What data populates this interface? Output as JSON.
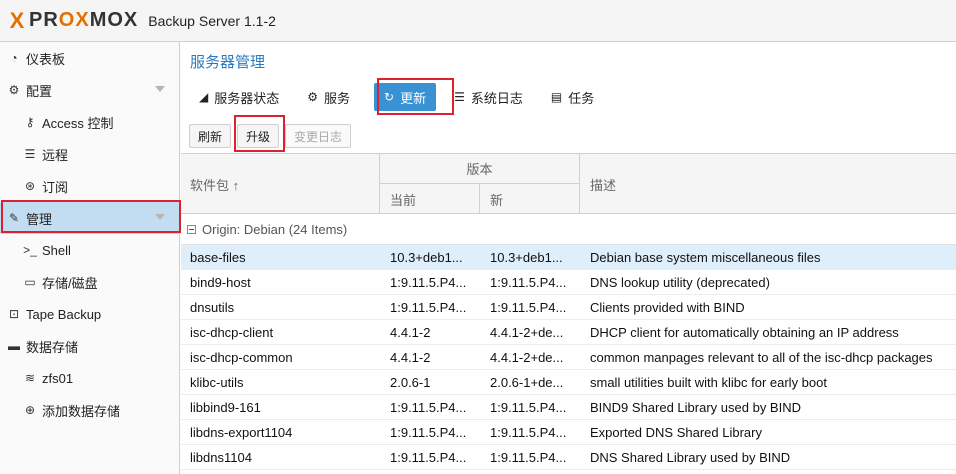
{
  "header": {
    "logo_mark": "X",
    "logo_word_a": "PR",
    "logo_word_b": "OX",
    "logo_word_c": "MOX",
    "product": "Backup Server 1.1-2",
    "brand_color": "#e57000"
  },
  "sidebar": {
    "items": [
      {
        "label": "仪表板",
        "icon": "dashboard-icon"
      },
      {
        "label": "配置",
        "icon": "gears-icon"
      },
      {
        "label": "Access 控制",
        "icon": "key-icon"
      },
      {
        "label": "远程",
        "icon": "server-icon"
      },
      {
        "label": "订阅",
        "icon": "support-icon"
      },
      {
        "label": "管理",
        "icon": "wrench-icon"
      },
      {
        "label": "Shell",
        "icon": "terminal-icon"
      },
      {
        "label": "存储/磁盘",
        "icon": "hdd-icon"
      },
      {
        "label": "Tape Backup",
        "icon": "tape-icon"
      },
      {
        "label": "数据存储",
        "icon": "archive-icon"
      },
      {
        "label": "zfs01",
        "icon": "database-icon"
      },
      {
        "label": "添加数据存储",
        "icon": "plus-circle-icon"
      }
    ]
  },
  "main": {
    "title": "服务器管理",
    "tabs": [
      {
        "label": "服务器状态",
        "icon": "area-chart-icon"
      },
      {
        "label": "服务",
        "icon": "gears-icon"
      },
      {
        "label": "更新",
        "icon": "refresh-icon"
      },
      {
        "label": "系统日志",
        "icon": "list-icon"
      },
      {
        "label": "任务",
        "icon": "list-alt-icon"
      }
    ],
    "toolbar": {
      "refresh": "刷新",
      "upgrade": "升级",
      "changelog": "变更日志"
    },
    "grid": {
      "col_package": "软件包 ↑",
      "col_version": "版本",
      "col_current": "当前",
      "col_new": "新",
      "col_description": "描述",
      "group": "Origin: Debian (24 Items)",
      "rows": [
        {
          "pkg": "base-files",
          "cur": "10.3+deb1...",
          "new": "10.3+deb1...",
          "desc": "Debian base system miscellaneous files"
        },
        {
          "pkg": "bind9-host",
          "cur": "1:9.11.5.P4...",
          "new": "1:9.11.5.P4...",
          "desc": "DNS lookup utility (deprecated)"
        },
        {
          "pkg": "dnsutils",
          "cur": "1:9.11.5.P4...",
          "new": "1:9.11.5.P4...",
          "desc": "Clients provided with BIND"
        },
        {
          "pkg": "isc-dhcp-client",
          "cur": "4.4.1-2",
          "new": "4.4.1-2+de...",
          "desc": "DHCP client for automatically obtaining an IP address"
        },
        {
          "pkg": "isc-dhcp-common",
          "cur": "4.4.1-2",
          "new": "4.4.1-2+de...",
          "desc": "common manpages relevant to all of the isc-dhcp packages"
        },
        {
          "pkg": "klibc-utils",
          "cur": "2.0.6-1",
          "new": "2.0.6-1+de...",
          "desc": "small utilities built with klibc for early boot"
        },
        {
          "pkg": "libbind9-161",
          "cur": "1:9.11.5.P4...",
          "new": "1:9.11.5.P4...",
          "desc": "BIND9 Shared Library used by BIND"
        },
        {
          "pkg": "libdns-export1104",
          "cur": "1:9.11.5.P4...",
          "new": "1:9.11.5.P4...",
          "desc": "Exported DNS Shared Library"
        },
        {
          "pkg": "libdns1104",
          "cur": "1:9.11.5.P4...",
          "new": "1:9.11.5.P4...",
          "desc": "DNS Shared Library used by BIND"
        }
      ]
    }
  },
  "colors": {
    "accent": "#3892d4",
    "title": "#2a7bc0",
    "highlight_box": "#d9242f",
    "selected_nav": "#c2ddf2"
  }
}
